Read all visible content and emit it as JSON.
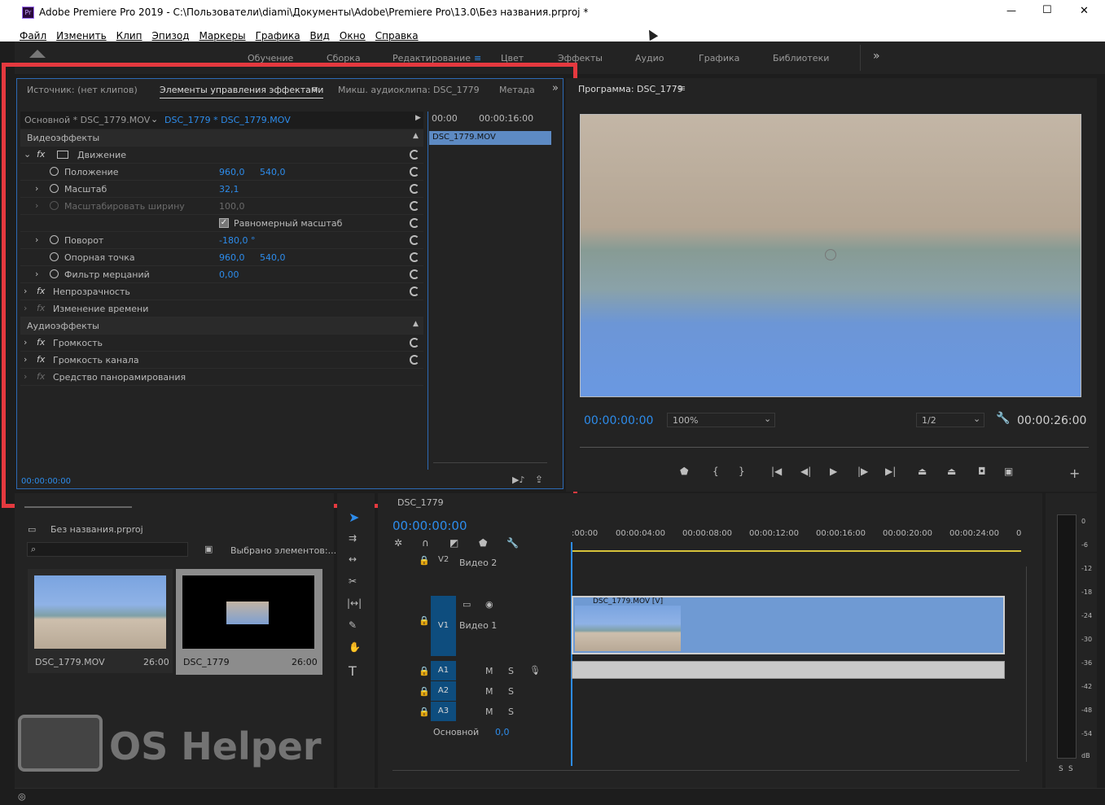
{
  "window": {
    "title": "Adobe Premiere Pro 2019 - C:\\Пользователи\\diami\\Документы\\Adobe\\Premiere Pro\\13.0\\Без названия.prproj *",
    "app_icon": "Pr",
    "min": "—",
    "max": "☐",
    "close": "✕"
  },
  "menu": [
    "Файл",
    "Изменить",
    "Клип",
    "Эпизод",
    "Маркеры",
    "Графика",
    "Вид",
    "Окно",
    "Справка"
  ],
  "workspaces": [
    "Обучение",
    "Сборка",
    "Редактирование",
    "Цвет",
    "Эффекты",
    "Аудио",
    "Графика",
    "Библиотеки"
  ],
  "workspaces_more": "»",
  "source_tabs": [
    "Источник: (нет клипов)",
    "Элементы управления эффектами",
    "Микш. аудиоклипа: DSC_1779",
    "Метада"
  ],
  "effects": {
    "master": "Основной * DSC_1779.MOV",
    "clip": "DSC_1779 * DSC_1779.MOV",
    "tc_start": "00:00",
    "tc_end": "00:00:16:00",
    "clip_bar": "DSC_1779.MOV",
    "video_header": "Видеоэффекты",
    "audio_header": "Аудиоэффекты",
    "motion": "Движение",
    "position": "Положение",
    "position_x": "960,0",
    "position_y": "540,0",
    "scale": "Масштаб",
    "scale_v": "32,1",
    "scale_w": "Масштабировать ширину",
    "scale_w_v": "100,0",
    "uniform": "Равномерный масштаб",
    "rotation": "Поворот",
    "rotation_v": "-180,0 °",
    "anchor": "Опорная точка",
    "anchor_x": "960,0",
    "anchor_y": "540,0",
    "flicker": "Фильтр мерцаний",
    "flicker_v": "0,00",
    "opacity": "Непрозрачность",
    "time_remap": "Изменение времени",
    "volume": "Громкость",
    "channel_volume": "Громкость канала",
    "panner": "Средство панорамирования",
    "timecode": "00:00:00:00",
    "fx": "fx"
  },
  "program": {
    "title": "Программа: DSC_1779",
    "timecode": "00:00:00:00",
    "zoom": "100%",
    "quality": "1/2",
    "duration": "00:00:26:00"
  },
  "project": {
    "file": "Без названия.prproj",
    "selected": "Выбрано элементов:...",
    "items": [
      {
        "name": "DSC_1779.MOV",
        "dur": "26:00"
      },
      {
        "name": "DSC_1779",
        "dur": "26:00"
      }
    ]
  },
  "timeline": {
    "tab": "DSC_1779",
    "timecode": "00:00:00:00",
    "ruler": [
      ":00:00",
      "00:00:04:00",
      "00:00:08:00",
      "00:00:12:00",
      "00:00:16:00",
      "00:00:20:00",
      "00:00:24:00",
      "0"
    ],
    "v2": "V2",
    "v2_name": "Видео 2",
    "v1": "V1",
    "v1_name": "Видео 1",
    "a1": "A1",
    "a2": "A2",
    "a3": "A3",
    "master": "Основной",
    "master_v": "0,0",
    "clip": "DSC_1779.MOV [V]",
    "m": "M",
    "s": "S"
  },
  "meter": [
    "0",
    "-6",
    "-12",
    "-18",
    "-24",
    "-30",
    "-36",
    "-42",
    "-48",
    "-54",
    "dB"
  ],
  "meter_ss": [
    "S",
    "S"
  ],
  "watermark": "OS Helper"
}
